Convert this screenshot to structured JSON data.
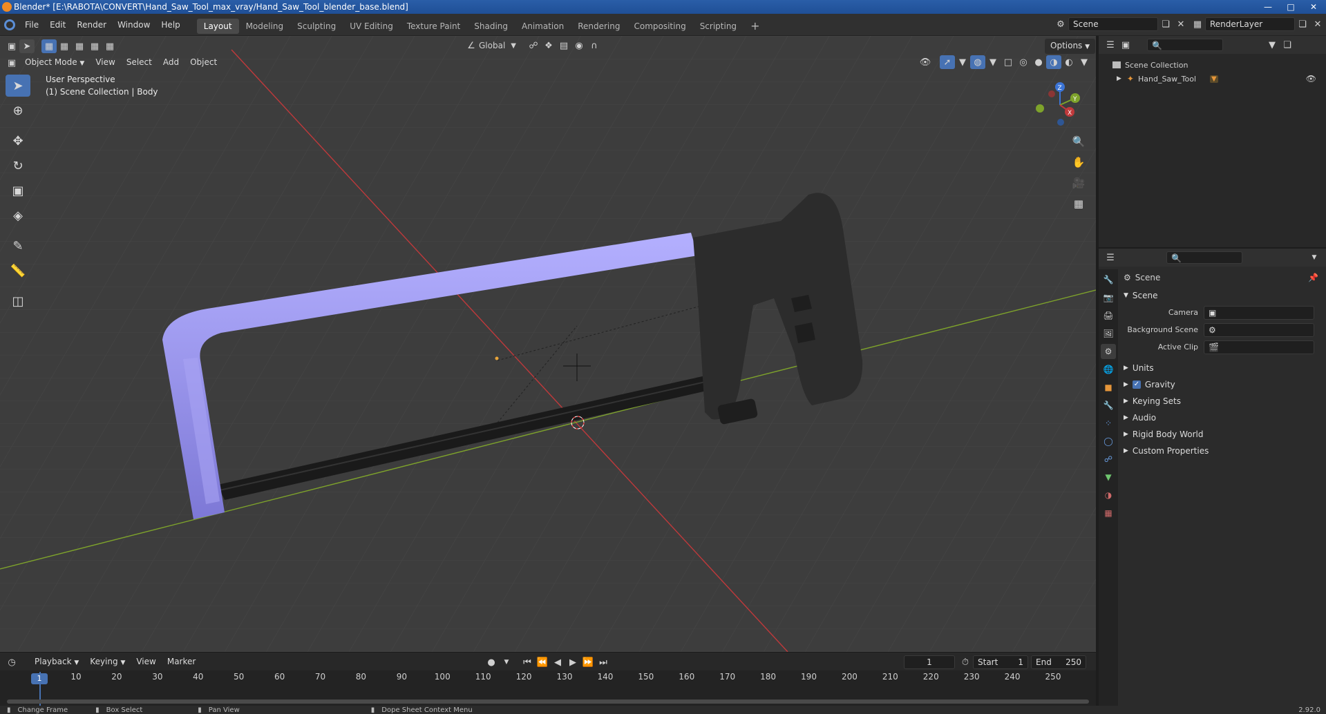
{
  "window": {
    "title": "Blender* [E:\\RABOTA\\CONVERT\\Hand_Saw_Tool_max_vray/Hand_Saw_Tool_blender_base.blend]",
    "titlebar_color": "#2a5ea8"
  },
  "menu": {
    "items": [
      "File",
      "Edit",
      "Render",
      "Window",
      "Help"
    ]
  },
  "workspaces": {
    "tabs": [
      "Layout",
      "Modeling",
      "Sculpting",
      "UV Editing",
      "Texture Paint",
      "Shading",
      "Animation",
      "Rendering",
      "Compositing",
      "Scripting"
    ],
    "active": "Layout",
    "add_icon": "plus-icon"
  },
  "topright": {
    "scene": "Scene",
    "view_layer": "RenderLayer"
  },
  "viewport_header": {
    "mode": "Object Mode",
    "menus": [
      "View",
      "Select",
      "Add",
      "Object"
    ],
    "transform_orientation": "Global",
    "options_label": "Options"
  },
  "viewport": {
    "perspective_label": "User Perspective",
    "collection_label": "(1) Scene Collection | Body",
    "background": "#3d3d3d",
    "saw_frame_color": "#9a95ee",
    "handle_color": "#2b2b2b",
    "axis_x_color": "#c0393b",
    "axis_y_color": "#7ea32b",
    "gizmo": {
      "x": "X",
      "y": "Y",
      "z": "Z"
    }
  },
  "outliner": {
    "root": "Scene Collection",
    "items": [
      {
        "label": "Hand_Saw_Tool"
      }
    ]
  },
  "properties": {
    "context": "Scene",
    "panel_title": "Scene",
    "fields": [
      {
        "label": "Camera",
        "value": ""
      },
      {
        "label": "Background Scene",
        "value": ""
      },
      {
        "label": "Active Clip",
        "value": ""
      }
    ],
    "sections": [
      "Units",
      "Gravity",
      "Keying Sets",
      "Audio",
      "Rigid Body World",
      "Custom Properties"
    ],
    "gravity_checked": true
  },
  "timeline": {
    "menus": [
      "Playback",
      "Keying",
      "View",
      "Marker"
    ],
    "current_frame": "1",
    "start_label": "Start",
    "start_value": "1",
    "end_label": "End",
    "end_value": "250",
    "ticks": [
      "1",
      "10",
      "20",
      "30",
      "40",
      "50",
      "60",
      "70",
      "80",
      "90",
      "100",
      "110",
      "120",
      "130",
      "140",
      "150",
      "160",
      "170",
      "180",
      "190",
      "200",
      "210",
      "220",
      "230",
      "240",
      "250"
    ]
  },
  "statusbar": {
    "items": [
      "Change Frame",
      "Box Select",
      "Pan View",
      "Dope Sheet Context Menu"
    ],
    "version": "2.92.0"
  }
}
